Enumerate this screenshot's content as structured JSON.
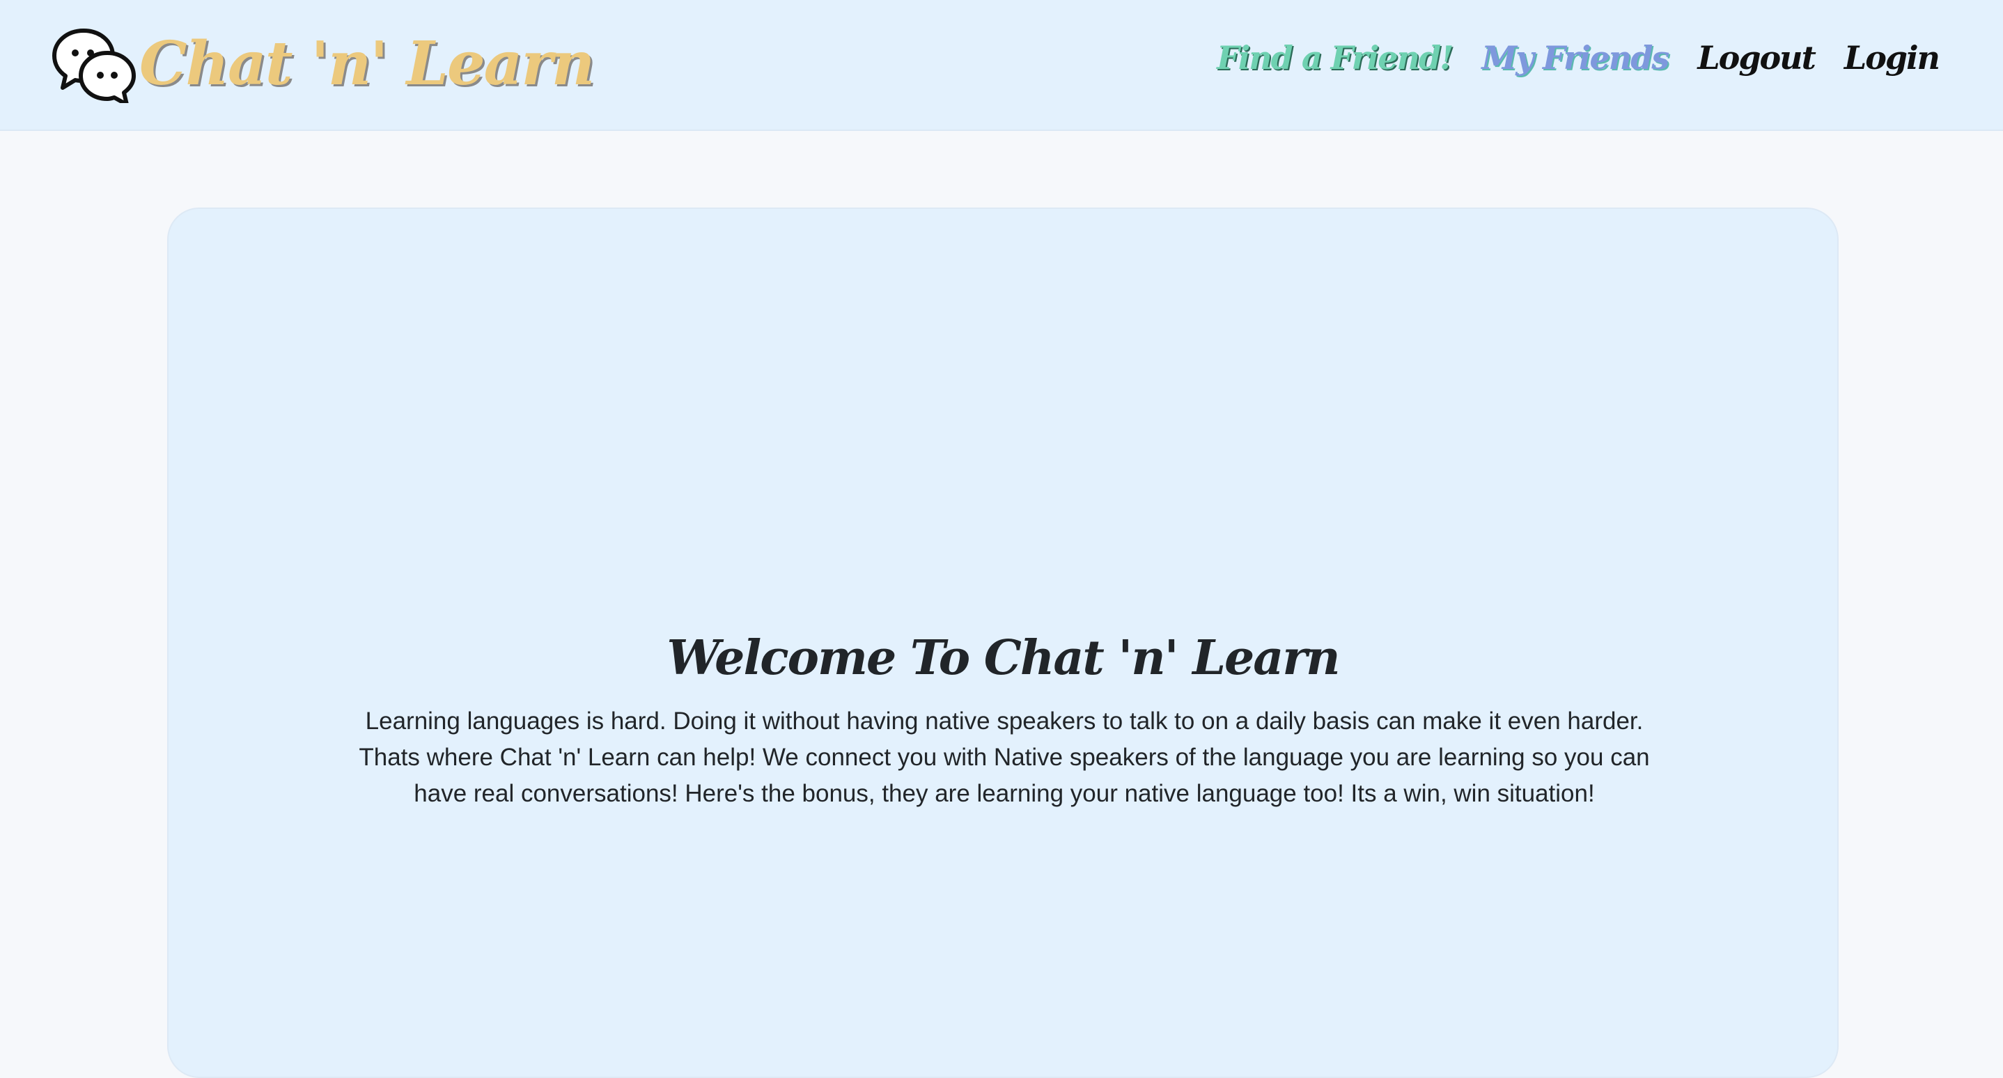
{
  "header": {
    "brand": {
      "name": "Chat 'n' Learn",
      "icon": "chat-bubbles-icon",
      "color": "#ecc97d"
    },
    "nav": {
      "find_friend": "Find a Friend!",
      "my_friends": "My Friends",
      "logout": "Logout",
      "login": "Login"
    },
    "colors": {
      "find_friend": "#6fd1b1",
      "my_friends": "#7e98dd",
      "background": "#e3f1fd"
    }
  },
  "hero": {
    "title": "Welcome To Chat 'n' Learn",
    "body": "Learning languages is hard. Doing it without having native speakers to talk to on a daily basis can make it even harder. Thats where Chat 'n' Learn can help! We connect you with Native speakers of the language you are learning so you can have real conversations! Here's the bonus, they are learning your native language too! Its a win, win situation!"
  }
}
